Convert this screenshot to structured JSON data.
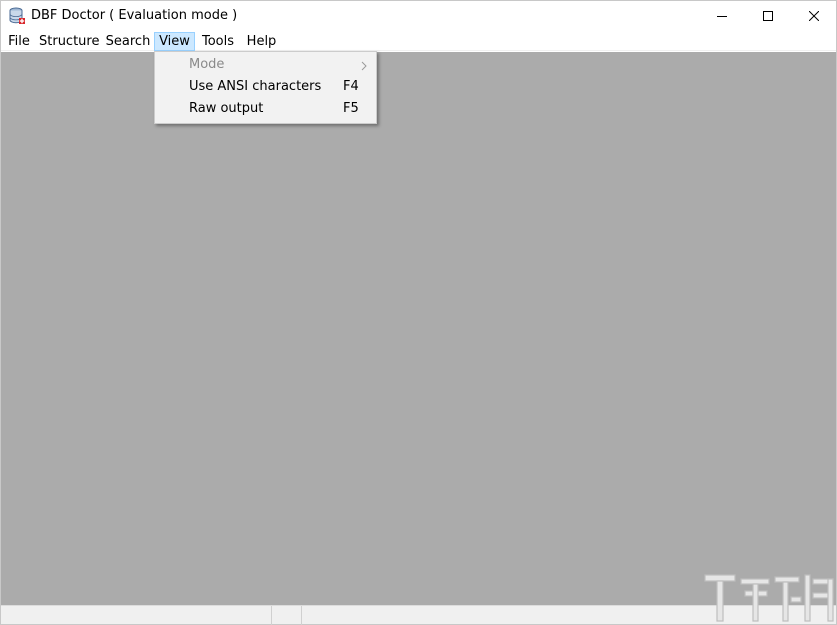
{
  "window": {
    "title": "DBF Doctor ( Evaluation mode )",
    "app_icon": "database-icon",
    "controls": {
      "minimize_icon": "minimize-icon",
      "maximize_icon": "maximize-icon",
      "close_icon": "close-icon"
    }
  },
  "menubar": {
    "items": [
      {
        "label": "File"
      },
      {
        "label": "Structure"
      },
      {
        "label": "Search"
      },
      {
        "label": "View",
        "active": true
      },
      {
        "label": "Tools"
      },
      {
        "label": "Help"
      }
    ]
  },
  "view_menu": {
    "items": [
      {
        "label": "Mode",
        "shortcut": "",
        "disabled": true,
        "submenu": true
      },
      {
        "label": "Use ANSI characters",
        "shortcut": "F4",
        "disabled": false
      },
      {
        "label": "Raw output",
        "shortcut": "F5",
        "disabled": false
      }
    ]
  },
  "colors": {
    "client_bg": "#ababab",
    "menu_highlight": "#cce8ff",
    "dropdown_bg": "#f2f2f2"
  }
}
